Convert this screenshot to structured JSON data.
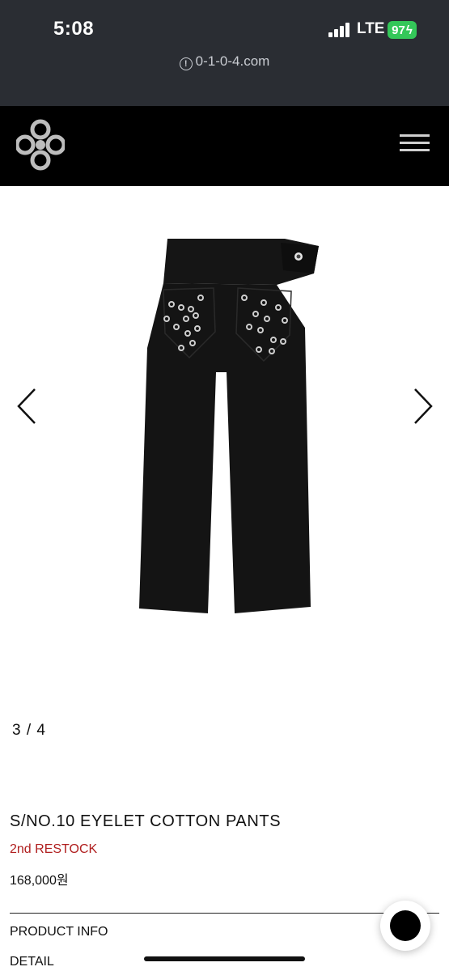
{
  "status_bar": {
    "time": "5:08",
    "network": "LTE",
    "battery": "97"
  },
  "browser": {
    "url": "0-1-0-4.com",
    "url_icon": "info-icon"
  },
  "header": {
    "logo_icon": "brand-logo-icon",
    "menu_icon": "hamburger-menu-icon"
  },
  "gallery": {
    "counter": "3 / 4",
    "prev_icon": "chevron-left-icon",
    "next_icon": "chevron-right-icon",
    "image": "black-eyelet-cotton-pants"
  },
  "product": {
    "name": "S/NO.10 EYELET COTTON PANTS",
    "tag": "2nd RESTOCK",
    "price": "168,000원",
    "tag_color": "#b01e1e"
  },
  "sections": {
    "info": "PRODUCT INFO",
    "detail": "DETAIL"
  }
}
